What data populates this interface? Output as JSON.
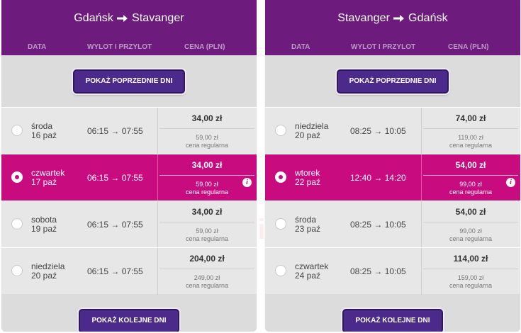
{
  "left": {
    "from": "Gdańsk",
    "to": "Stavanger",
    "columns": {
      "date": "DATA",
      "flight": "WYLOT I PRZYLOT",
      "price": "CENA (PLN)"
    },
    "prev_button": "POKAŻ POPRZEDNIE DNI",
    "next_button": "POKAŻ KOLEJNE DNI",
    "rows": [
      {
        "day": "środa",
        "date": "16 paź",
        "times": "06:15 → 07:55",
        "price": "34,00 zł",
        "regular": "59,00 zł",
        "regular_label": "cena regularna"
      },
      {
        "day": "czwartek",
        "date": "17 paź",
        "times": "06:15 → 07:55",
        "price": "34,00 zł",
        "regular": "59,00 zł",
        "regular_label": "cena regularna"
      },
      {
        "day": "sobota",
        "date": "19 paź",
        "times": "06:15 → 07:55",
        "price": "34,00 zł",
        "regular": "59,00 zł",
        "regular_label": "cena regularna"
      },
      {
        "day": "niedziela",
        "date": "20 paź",
        "times": "06:15 → 07:55",
        "price": "204,00 zł",
        "regular": "249,00 zł",
        "regular_label": "cena regularna"
      }
    ]
  },
  "right": {
    "from": "Stavanger",
    "to": "Gdańsk",
    "columns": {
      "date": "DATA",
      "flight": "WYLOT I PRZYLOT",
      "price": "CENA (PLN)"
    },
    "prev_button": "POKAŻ POPRZEDNIE DNI",
    "next_button": "POKAŻ KOLEJNE DNI",
    "rows": [
      {
        "day": "niedziela",
        "date": "20 paź",
        "times": "08:25 → 10:05",
        "price": "74,00 zł",
        "regular": "119,00 zł",
        "regular_label": "cena regularna"
      },
      {
        "day": "wtorek",
        "date": "22 paź",
        "times": "12:40 → 14:20",
        "price": "54,00 zł",
        "regular": "99,00 zł",
        "regular_label": "cena regularna"
      },
      {
        "day": "środa",
        "date": "23 paź",
        "times": "08:25 → 10:05",
        "price": "54,00 zł",
        "regular": "99,00 zł",
        "regular_label": "cena regularna"
      },
      {
        "day": "czwartek",
        "date": "24 paź",
        "times": "08:25 → 10:05",
        "price": "114,00 zł",
        "regular": "159,00 zł",
        "regular_label": "cena regularna"
      }
    ]
  },
  "selected": {
    "left_row": 1,
    "right_row": 1
  },
  "info_glyph": "i",
  "watermark": "www.mieszneppodroze.pl",
  "colors": {
    "header": "#6d1c7d",
    "selected_row": "#c90b80",
    "button": "#4b2a8b"
  },
  "icons": {
    "route_arrow": "arrow-right-icon",
    "info": "info-icon"
  }
}
